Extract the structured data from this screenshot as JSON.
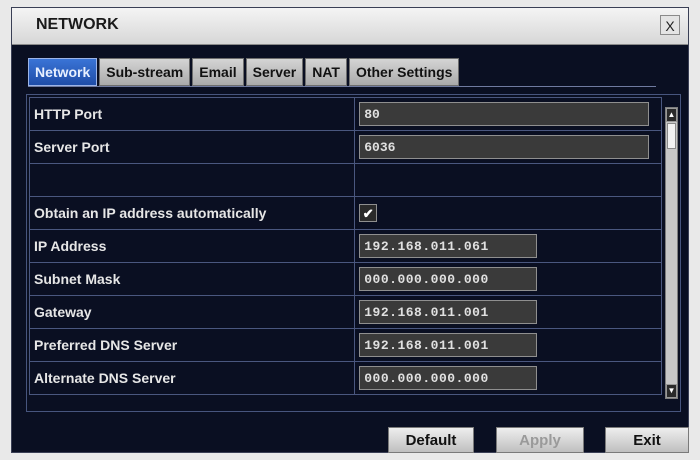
{
  "window": {
    "title": "NETWORK",
    "close_label": "X"
  },
  "tabs": [
    {
      "label": "Network",
      "active": true
    },
    {
      "label": "Sub-stream",
      "active": false
    },
    {
      "label": "Email",
      "active": false
    },
    {
      "label": "Server",
      "active": false
    },
    {
      "label": "NAT",
      "active": false
    },
    {
      "label": "Other Settings",
      "active": false
    }
  ],
  "rows": [
    {
      "label": "HTTP Port",
      "value": "80"
    },
    {
      "label": "Server Port",
      "value": "6036"
    },
    {
      "label": "",
      "value": ""
    },
    {
      "label": "Obtain an IP address automatically",
      "checked": true
    },
    {
      "label": "IP Address",
      "value": "192.168.011.061"
    },
    {
      "label": "Subnet Mask",
      "value": "000.000.000.000"
    },
    {
      "label": "Gateway",
      "value": "192.168.011.001"
    },
    {
      "label": "Preferred DNS Server",
      "value": "192.168.011.001"
    },
    {
      "label": "Alternate DNS Server",
      "value": "000.000.000.000"
    }
  ],
  "checkbox_mark": "✔",
  "buttons": {
    "default": "Default",
    "apply": "Apply",
    "exit": "Exit"
  },
  "icons": {
    "scroll_up": "▲",
    "scroll_down": "▼"
  }
}
